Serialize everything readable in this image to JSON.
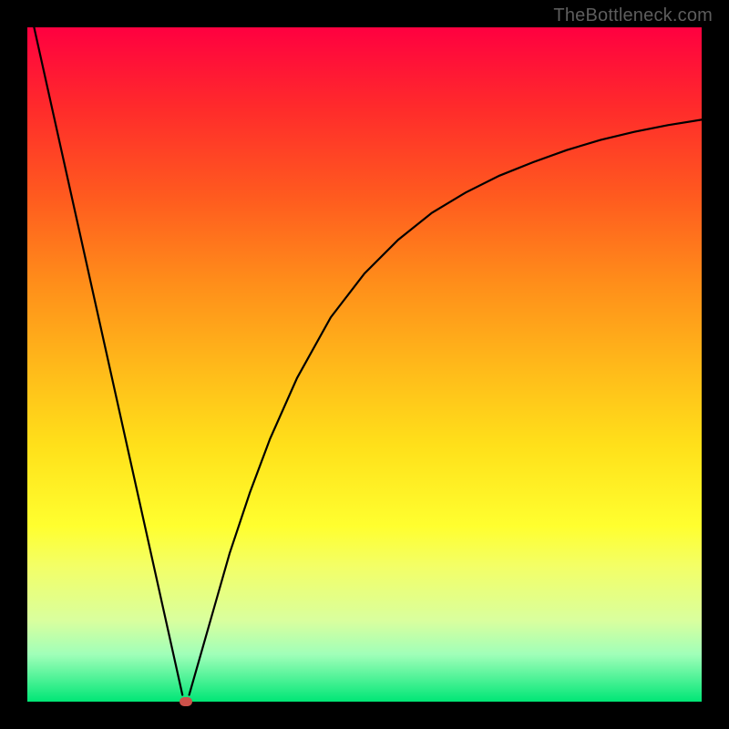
{
  "watermark": "TheBottleneck.com",
  "colors": {
    "frame": "#000000",
    "curve_stroke": "#000000",
    "marker": "#cc514a"
  },
  "chart_data": {
    "type": "line",
    "title": "",
    "xlabel": "",
    "ylabel": "",
    "xlim": [
      0,
      100
    ],
    "ylim": [
      0,
      100
    ],
    "marker_point": {
      "x": 23.5,
      "y": 0
    },
    "series": [
      {
        "name": "left-segment",
        "x": [
          1,
          5,
          10,
          15,
          20,
          22,
          23
        ],
        "values": [
          100,
          82,
          59.5,
          37,
          14.5,
          5.5,
          1
        ]
      },
      {
        "name": "right-segment",
        "x": [
          24,
          26,
          28,
          30,
          33,
          36,
          40,
          45,
          50,
          55,
          60,
          65,
          70,
          75,
          80,
          85,
          90,
          95,
          100
        ],
        "values": [
          1,
          8,
          15,
          22,
          31,
          39,
          48,
          57,
          63.5,
          68.5,
          72.5,
          75.5,
          78,
          80,
          81.8,
          83.3,
          84.5,
          85.5,
          86.3
        ]
      }
    ]
  }
}
